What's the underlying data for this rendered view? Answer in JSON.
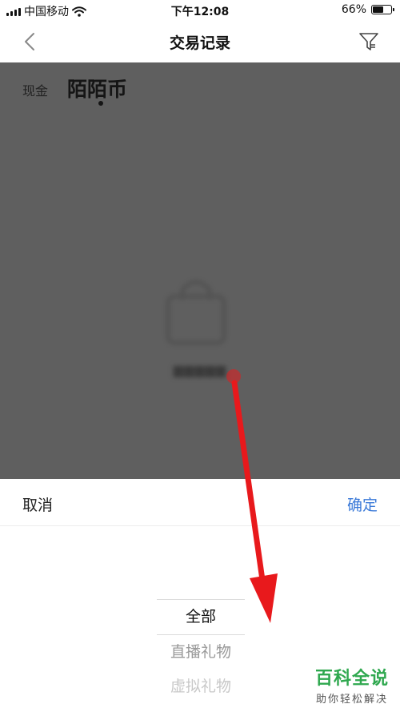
{
  "status_bar": {
    "carrier": "中国移动",
    "time": "下午12:08",
    "battery_percent_label": "66%",
    "battery_level": 0.66
  },
  "nav": {
    "title": "交易记录",
    "back_icon": "chevron-left-icon",
    "filter_icon": "filter-icon"
  },
  "tabs": {
    "cash": "现金",
    "coin": "陌陌币"
  },
  "picker": {
    "cancel_label": "取消",
    "confirm_label": "确定",
    "options": [
      "全部",
      "直播礼物",
      "虚拟礼物"
    ],
    "selected": "全部"
  },
  "annotation": {
    "arrow_color": "#e8191c"
  },
  "watermark": {
    "title": "百科全说",
    "subtitle": "助你轻松解决"
  },
  "colors": {
    "accent": "#3a79d8",
    "overlay": "#5f5f5f",
    "watermark": "#2fa84f"
  }
}
